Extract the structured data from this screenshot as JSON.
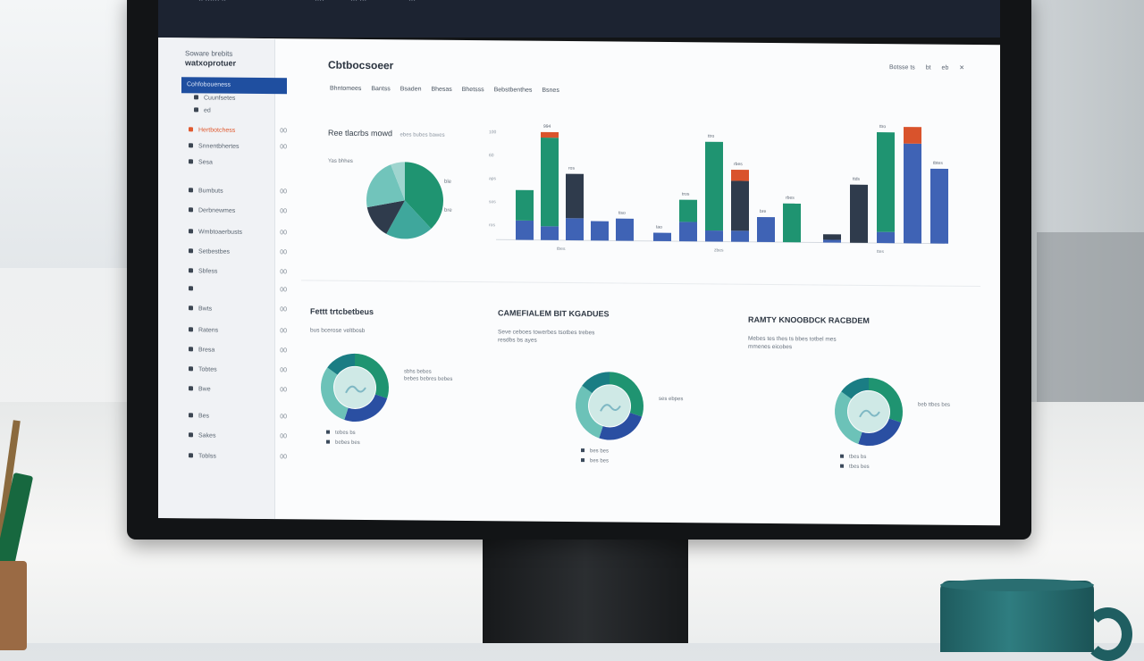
{
  "topbar": {
    "items": [
      "·· ······ ··",
      "····",
      "··· ···",
      "···"
    ]
  },
  "sidebar": {
    "header_small": "Soware brebits",
    "header_bold": "watxoprotuer",
    "active_item": "Cohfoboueness",
    "items": [
      {
        "label": "Cuunfsetes",
        "count": ""
      },
      {
        "label": "ed",
        "count": ""
      },
      {
        "label": "Hertbotchess",
        "count": "00",
        "alert": true
      },
      {
        "label": "Snnentbhertes",
        "count": "00"
      },
      {
        "label": "Sesa",
        "count": ""
      },
      {
        "label": "Bumbuts",
        "count": "00"
      },
      {
        "label": "Derbnewmes",
        "count": "00"
      },
      {
        "label": "Wmbtoaerbusts",
        "count": "00"
      },
      {
        "label": "Setbestbes",
        "count": "00"
      },
      {
        "label": "Sbfess",
        "count": "00"
      },
      {
        "label": "",
        "count": "00"
      },
      {
        "label": "Bwts",
        "count": "00"
      },
      {
        "label": "Ratens",
        "count": "00"
      },
      {
        "label": "Bresa",
        "count": "00"
      },
      {
        "label": "Tobtes",
        "count": "00"
      },
      {
        "label": "Bwe",
        "count": "00"
      },
      {
        "label": "Bes",
        "count": "00"
      },
      {
        "label": "Sakes",
        "count": "00"
      },
      {
        "label": "Toblss",
        "count": "00"
      }
    ]
  },
  "main": {
    "title": "Cbtbocsoeer",
    "tabs": [
      "Bhntomees",
      "Bantss",
      "Bsaden",
      "Bhesas",
      "Bhetsss",
      "Bebstbenthes",
      "Bsnes"
    ],
    "header_right": [
      "Botsse ts",
      "bt",
      "eb",
      "✕"
    ],
    "pie_title": "Ree tlacrbs mowd",
    "pie_sub": "ebes bubes bawes",
    "pie_labels": [
      "Yas bhhes",
      "ble",
      "bre"
    ]
  },
  "chart_data": {
    "type": "bar",
    "groups": [
      {
        "bars": [
          {
            "label": "",
            "segments": {
              "blue": 7,
              "green": 11,
              "red": 0
            }
          },
          {
            "label": "994",
            "segments": {
              "blue": 5,
              "green": 32,
              "red": 2
            }
          },
          {
            "label": "ros",
            "segments": {
              "blue": 8,
              "dark": 16,
              "red": 0
            }
          },
          {
            "label": "",
            "segments": {
              "blue": 7
            }
          },
          {
            "label": "tiso",
            "segments": {
              "blue": 8
            }
          }
        ]
      },
      {
        "bars": [
          {
            "label": "tao",
            "segments": {
              "blue": 3
            }
          },
          {
            "label": "tros",
            "segments": {
              "blue": 7,
              "green": 8
            }
          },
          {
            "label": "ttro",
            "segments": {
              "blue": 4,
              "green": 32
            }
          },
          {
            "label": "rbes",
            "segments": {
              "blue": 4,
              "dark": 18,
              "red": 4
            }
          },
          {
            "label": "bre",
            "segments": {
              "blue": 9
            }
          },
          {
            "label": "rbes",
            "segments": {
              "green": 14
            }
          }
        ]
      },
      {
        "bars": [
          {
            "label": "",
            "segments": {
              "blue": 1,
              "dark": 2
            }
          },
          {
            "label": "ttds",
            "segments": {
              "dark": 21
            }
          },
          {
            "label": "ttro",
            "segments": {
              "blue": 4,
              "green": 36
            }
          },
          {
            "label": "",
            "segments": {
              "blue": 36,
              "red": 6
            }
          },
          {
            "label": "tbtes",
            "segments": {
              "blue": 27
            }
          }
        ]
      }
    ],
    "x_labels": [
      "tbes",
      "zbes",
      "ttes"
    ],
    "y_ticks": [
      "100",
      "60",
      "aps",
      "sos",
      "ros"
    ],
    "colors": {
      "blue": "#3f63b5",
      "green": "#1f9471",
      "red": "#d9532c",
      "dark": "#2f3b4c"
    }
  },
  "sections": [
    {
      "title": "Fettt trtcbetbeus",
      "sub": "bus bcerose veltbosb",
      "callout": "sbhs bebes\nbebes bebres bebes",
      "legend": [
        "tebes bs",
        "bebes bes"
      ]
    },
    {
      "title": "CAMEFIALEM BIT KGADUES",
      "sub": "Seve ceboes towerbes tsotbes trebes\nresdbs bs ayes",
      "callout": "ses ebpes",
      "legend": [
        "bes bes",
        "bes bes"
      ]
    },
    {
      "title": "RAMTY KNOOBDCK RACBDEM",
      "sub": "Mebes tes thes ts bbes totbel mes\nmmenes eicobes",
      "callout": "beb ttbes bes",
      "legend": [
        "tbes bs",
        "tbes bes"
      ]
    }
  ],
  "donut_colors": [
    "#1f9471",
    "#2a4fa2",
    "#6cc2b8",
    "#1a7d84"
  ]
}
